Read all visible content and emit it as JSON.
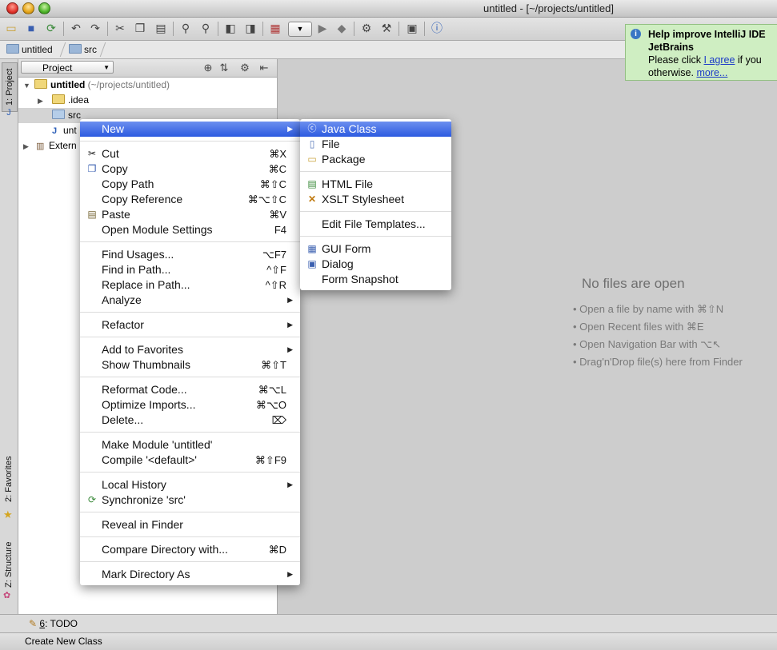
{
  "window": {
    "title": "untitled - [~/projects/untitled]"
  },
  "navbar": {
    "crumb1": "untitled",
    "crumb2": "src"
  },
  "left_tabs": {
    "project": "1: Project",
    "favorites": "2: Favorites",
    "structure": "Z: Structure"
  },
  "project_panel": {
    "view_selector": "Project",
    "tree": {
      "root_name": "untitled",
      "root_path": "(~/projects/untitled)",
      "idea": ".idea",
      "src": "src",
      "iml": "unt",
      "external": "Extern"
    }
  },
  "editor": {
    "no_files": "No files are open",
    "hints": [
      "• Open a file by name with ⌘⇧N",
      "• Open Recent files with ⌘E",
      "• Open Navigation Bar with ⌥↖",
      "• Drag'n'Drop file(s) here from Finder"
    ]
  },
  "notification": {
    "title": "Help improve IntelliJ IDE",
    "subtitle": "JetBrains",
    "line1_pre": "Please click ",
    "agree_link": "I agree",
    "line1_post": " if you",
    "line2_pre": "otherwise. ",
    "more_link": "more..."
  },
  "context_menu": {
    "new": "New",
    "cut": "Cut",
    "cut_sc": "⌘X",
    "copy": "Copy",
    "copy_sc": "⌘C",
    "copy_path": "Copy Path",
    "copy_path_sc": "⌘⇧C",
    "copy_reference": "Copy Reference",
    "copy_reference_sc": "⌘⌥⇧C",
    "paste": "Paste",
    "paste_sc": "⌘V",
    "open_module_settings": "Open Module Settings",
    "open_module_settings_sc": "F4",
    "find_usages": "Find Usages...",
    "find_usages_sc": "⌥F7",
    "find_in_path": "Find in Path...",
    "find_in_path_sc": "^⇧F",
    "replace_in_path": "Replace in Path...",
    "replace_in_path_sc": "^⇧R",
    "analyze": "Analyze",
    "refactor": "Refactor",
    "add_to_favorites": "Add to Favorites",
    "show_thumbnails": "Show Thumbnails",
    "show_thumbnails_sc": "⌘⇧T",
    "reformat_code": "Reformat Code...",
    "reformat_code_sc": "⌘⌥L",
    "optimize_imports": "Optimize Imports...",
    "optimize_imports_sc": "⌘⌥O",
    "delete": "Delete...",
    "delete_sc": "⌦",
    "make_module": "Make Module 'untitled'",
    "compile": "Compile '<default>'",
    "compile_sc": "⌘⇧F9",
    "local_history": "Local History",
    "synchronize": "Synchronize 'src'",
    "reveal_in_finder": "Reveal in Finder",
    "compare_directory": "Compare Directory with...",
    "compare_directory_sc": "⌘D",
    "mark_directory_as": "Mark Directory As"
  },
  "new_submenu": {
    "java_class": "Java Class",
    "file": "File",
    "package": "Package",
    "html_file": "HTML File",
    "xslt_stylesheet": "XSLT Stylesheet",
    "edit_file_templates": "Edit File Templates...",
    "gui_form": "GUI Form",
    "dialog": "Dialog",
    "form_snapshot": "Form Snapshot"
  },
  "bottom_tools": {
    "todo_num": "6",
    "todo_label": ": TODO"
  },
  "status": {
    "text": "Create New Class"
  }
}
